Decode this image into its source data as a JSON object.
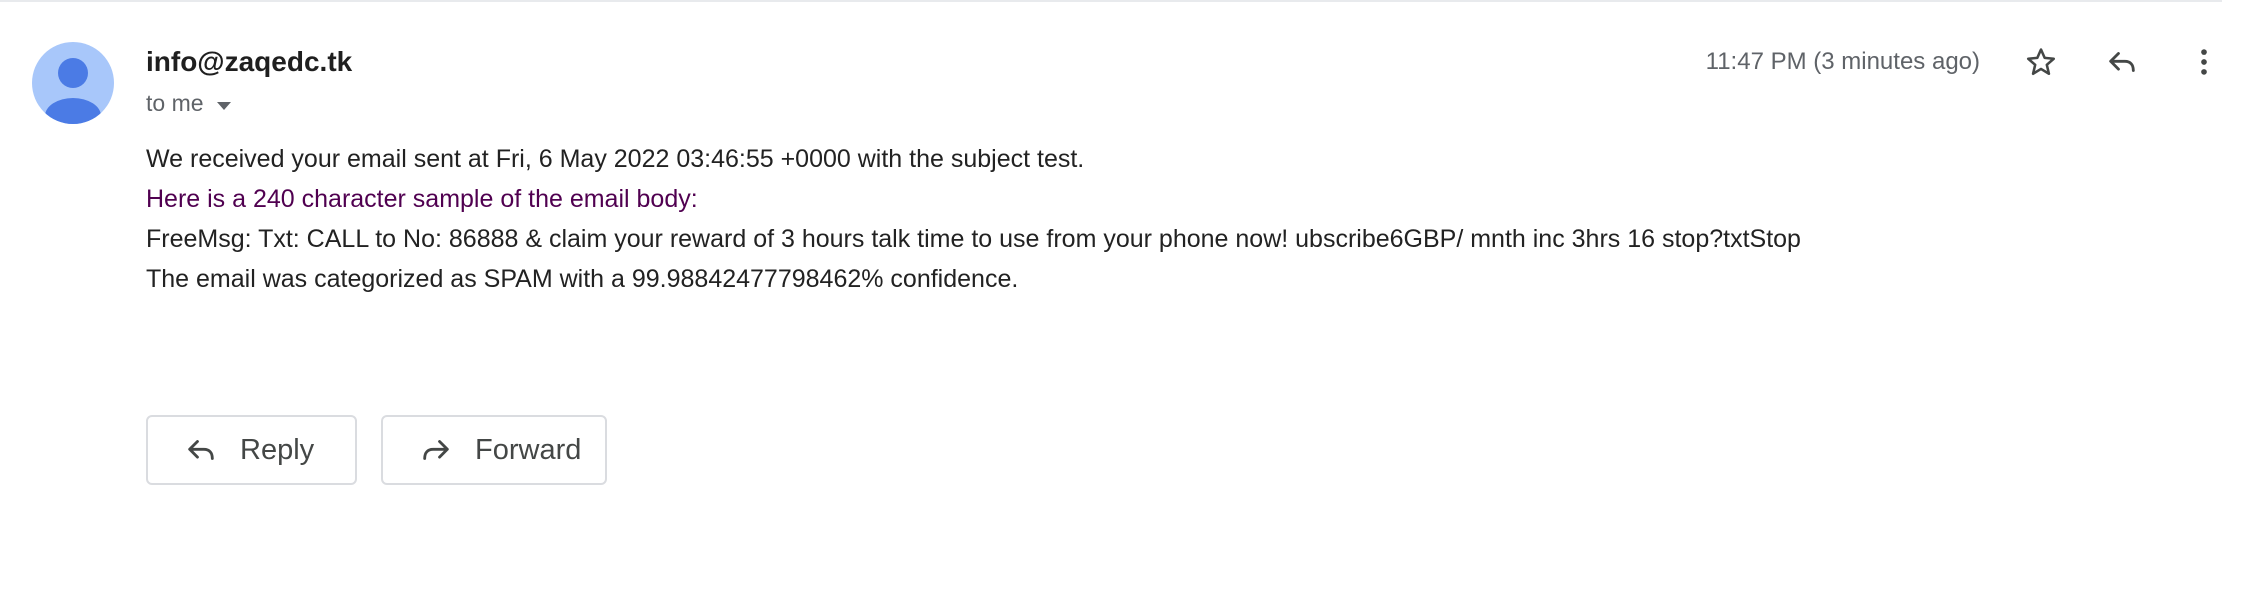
{
  "message": {
    "sender": "info@zaqedc.tk",
    "recipient_label": "to me",
    "timestamp": "11:47 PM (3 minutes ago)",
    "body": {
      "line1": "We received your email sent at Fri, 6 May 2022 03:46:55 +0000 with the subject test.",
      "line2": "Here is a 240 character sample of the email body:",
      "line3": "FreeMsg: Txt: CALL to No: 86888 & claim your reward of 3 hours talk time to use from your phone now! ubscribe6GBP/ mnth inc 3hrs 16 stop?txtStop",
      "line4": "The email was categorized as SPAM with a 99.98842477798462% confidence."
    }
  },
  "actions": {
    "reply_label": "Reply",
    "forward_label": "Forward"
  },
  "icons": {
    "avatar": "avatar-person-icon",
    "recipient_caret": "caret-down-icon",
    "star": "star-icon",
    "reply": "reply-icon",
    "more": "more-vert-icon",
    "forward": "forward-icon"
  },
  "colors": {
    "avatar_bg": "#a8c7fa",
    "avatar_fg": "#4b7be5",
    "quoted_text": "#500050"
  }
}
